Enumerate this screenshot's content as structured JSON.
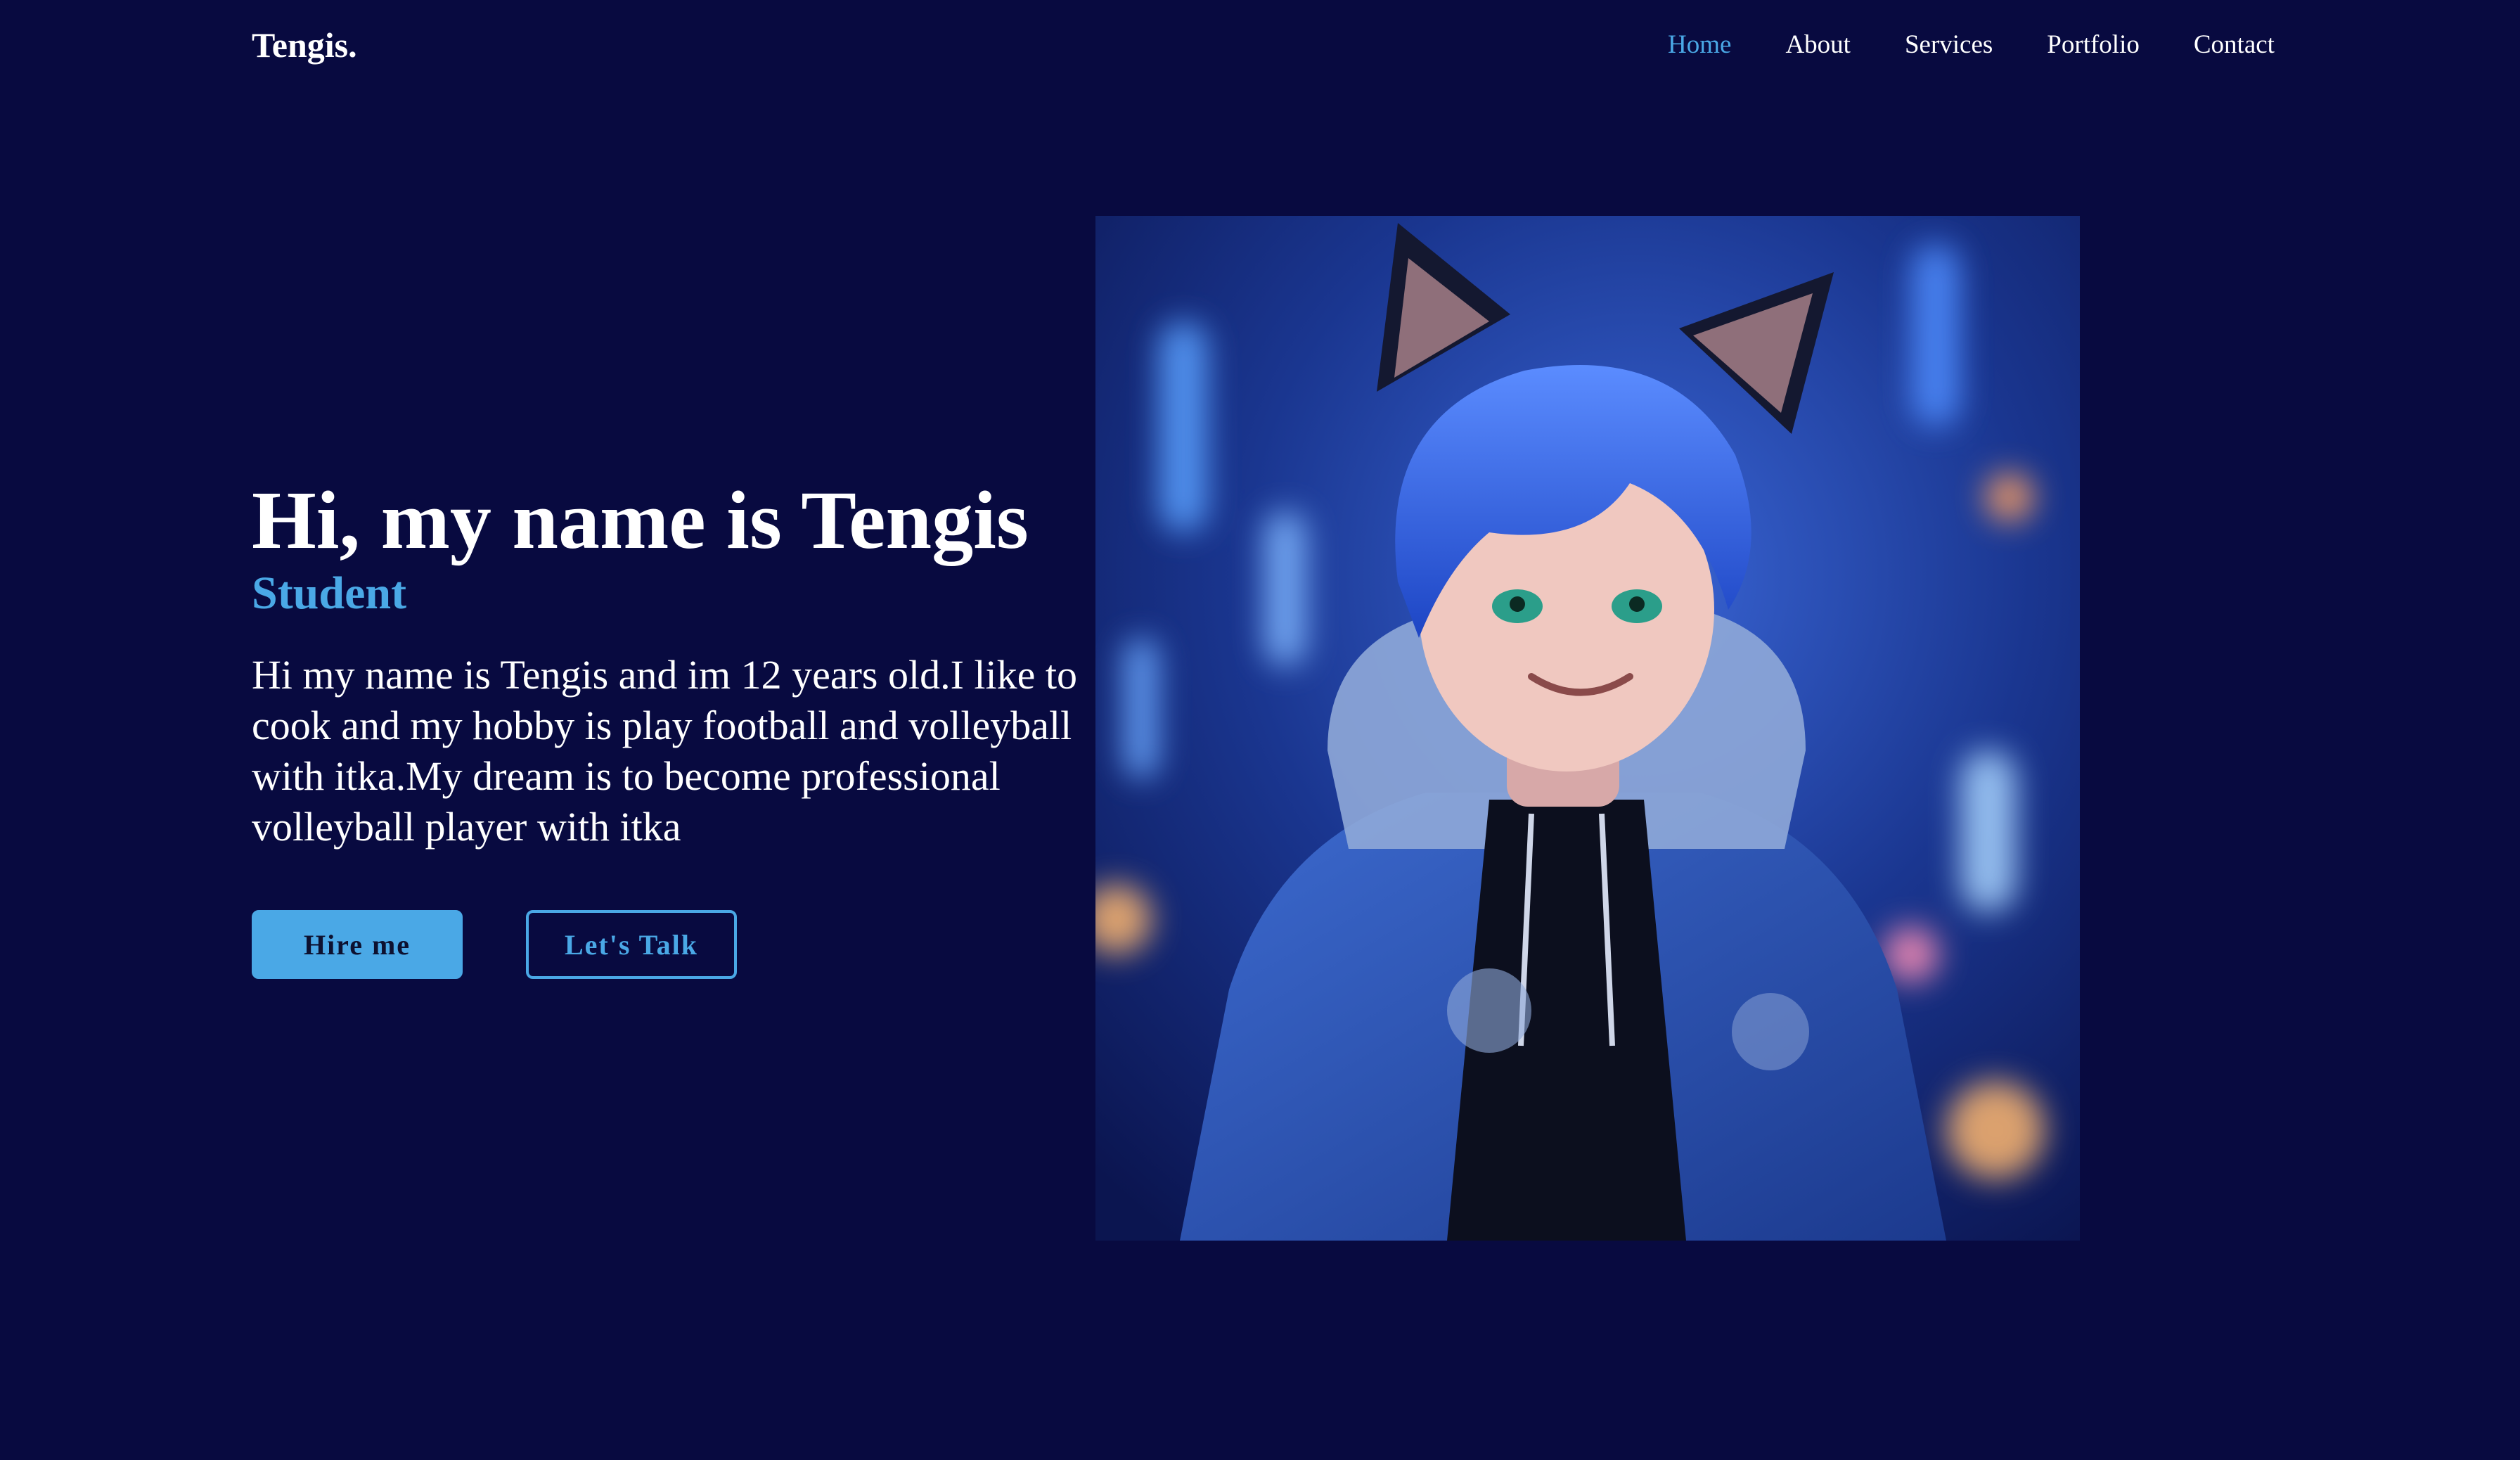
{
  "header": {
    "logo": "Tengis.",
    "nav": [
      {
        "label": "Home",
        "active": true
      },
      {
        "label": "About",
        "active": false
      },
      {
        "label": "Services",
        "active": false
      },
      {
        "label": "Portfolio",
        "active": false
      },
      {
        "label": "Contact",
        "active": false
      }
    ]
  },
  "hero": {
    "title": "Hi, my name is Tengis",
    "role": "Student",
    "description": "Hi my name is Tengis and im 12 years old.I like to cook and my hobby is play football and volleyball with itka.My dream is to become professional volleyball player with itka",
    "buttons": {
      "primary": "Hire me",
      "secondary": "Let's Talk"
    }
  },
  "colors": {
    "background": "#080a40",
    "accent": "#4aa8e6",
    "text": "#ffffff"
  }
}
